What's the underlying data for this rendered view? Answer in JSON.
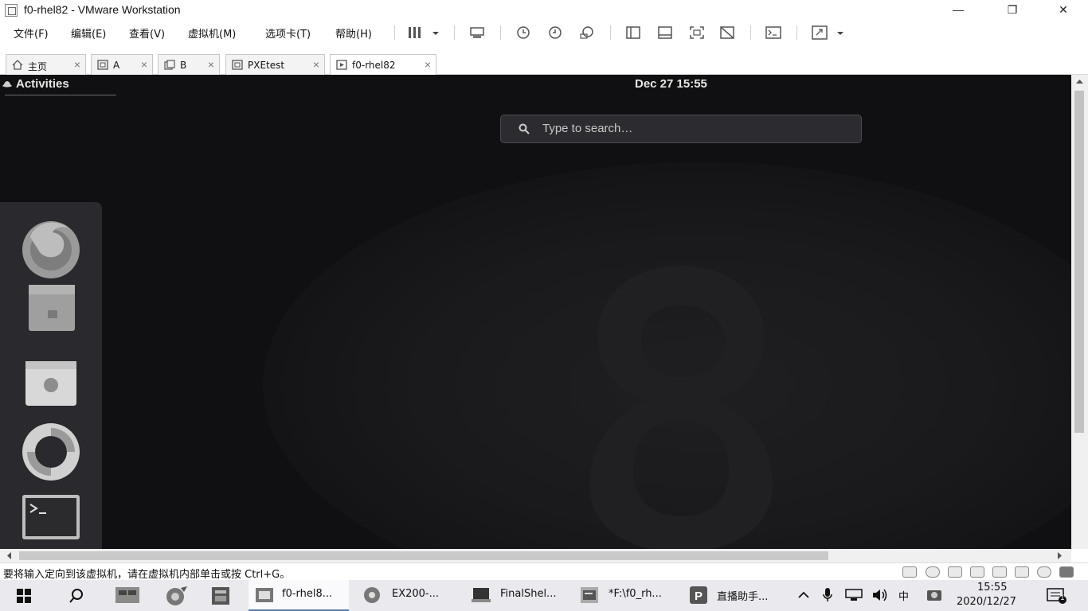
{
  "window": {
    "title": "f0-rhel82 - VMware Workstation",
    "minimize": "—",
    "restore": "❐",
    "close": "✕"
  },
  "menu": [
    "文件(F)",
    "编辑(E)",
    "查看(V)",
    "虚拟机(M)",
    "选项卡(T)",
    "帮助(H)"
  ],
  "tabs": [
    {
      "label": "主页",
      "icon": "home-icon"
    },
    {
      "label": "A",
      "icon": "vm-icon"
    },
    {
      "label": "B",
      "icon": "vm-group-icon"
    },
    {
      "label": "PXEtest",
      "icon": "vm-icon"
    },
    {
      "label": "f0-rhel82",
      "icon": "vm-running-icon",
      "active": true
    }
  ],
  "tab_close": "×",
  "vm": {
    "activities": "Activities",
    "clock": "Dec 27  15:55",
    "search_placeholder": "Type to search…",
    "dash": [
      "firefox-icon",
      "files-icon",
      "software-icon",
      "help-icon",
      "terminal-icon"
    ]
  },
  "status": {
    "text": "要将输入定向到该虚拟机，请在虚拟机内部单击或按 Ctrl+G。"
  },
  "taskbar": {
    "items": [
      {
        "label": "f0-rhel8...",
        "icon": "vmware-icon",
        "active": true
      },
      {
        "label": "EX200-...",
        "icon": "disc-icon"
      },
      {
        "label": "FinalShel...",
        "icon": "finalshell-icon"
      },
      {
        "label": "*F:\\f0_rh...",
        "icon": "editor-icon"
      },
      {
        "label": "直播助手...",
        "icon": "live-assistant-icon"
      }
    ],
    "ime": "中",
    "time": "15:55",
    "date": "2020/12/27",
    "notifications": "1"
  },
  "colors": {
    "vm_bg": "#101012",
    "dash_bg": "#2a2a2e",
    "taskbar_bg": "#e9e9ee"
  }
}
